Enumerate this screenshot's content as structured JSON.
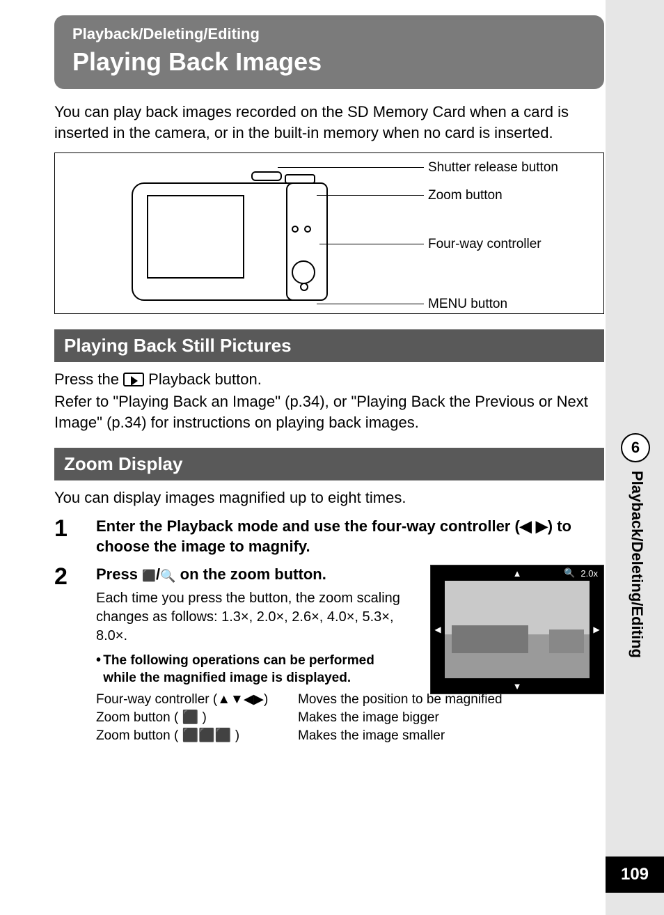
{
  "header": {
    "breadcrumb": "Playback/Deleting/Editing",
    "title": "Playing Back Images"
  },
  "intro": "You can play back images recorded on the SD Memory Card when a card is inserted in the camera, or in the built-in memory when no card is inserted.",
  "diagram_labels": {
    "shutter": "Shutter release button",
    "zoom": "Zoom button",
    "fourway": "Four-way controller",
    "menu": "MENU button"
  },
  "section1": {
    "title": "Playing Back Still Pictures",
    "line1a": "Press the ",
    "line1b": " Playback button.",
    "line2": "Refer to \"Playing Back an Image\" (p.34), or \"Playing Back the Previous or Next Image\" (p.34) for instructions on playing back images."
  },
  "section2": {
    "title": "Zoom Display",
    "intro": "You can display images magnified up to eight times.",
    "step1_num": "1",
    "step1_title": "Enter the Playback mode and use the four-way controller (◀ ▶) to choose the image to magnify.",
    "step2_num": "2",
    "step2_title_a": "Press ",
    "step2_title_b": " on the zoom button.",
    "step2_body": "Each time you press the button, the zoom scaling changes as follows: 1.3×, 2.0×, 2.6×, 4.0×, 5.3×, 8.0×.",
    "bullet": "The following operations can be performed while the magnified image is displayed.",
    "ops": [
      {
        "l": "Four-way controller (▲▼◀▶)",
        "r": "Moves the position to be magnified"
      },
      {
        "l": "Zoom button ( ⬛ )",
        "r": "Makes the image bigger"
      },
      {
        "l": "Zoom button ( ⬛⬛⬛ )",
        "r": "Makes the image smaller"
      }
    ],
    "zoom_overlay": "2.0x"
  },
  "side": {
    "chapter_num": "6",
    "chapter_label": "Playback/Deleting/Editing",
    "page_num": "109"
  }
}
